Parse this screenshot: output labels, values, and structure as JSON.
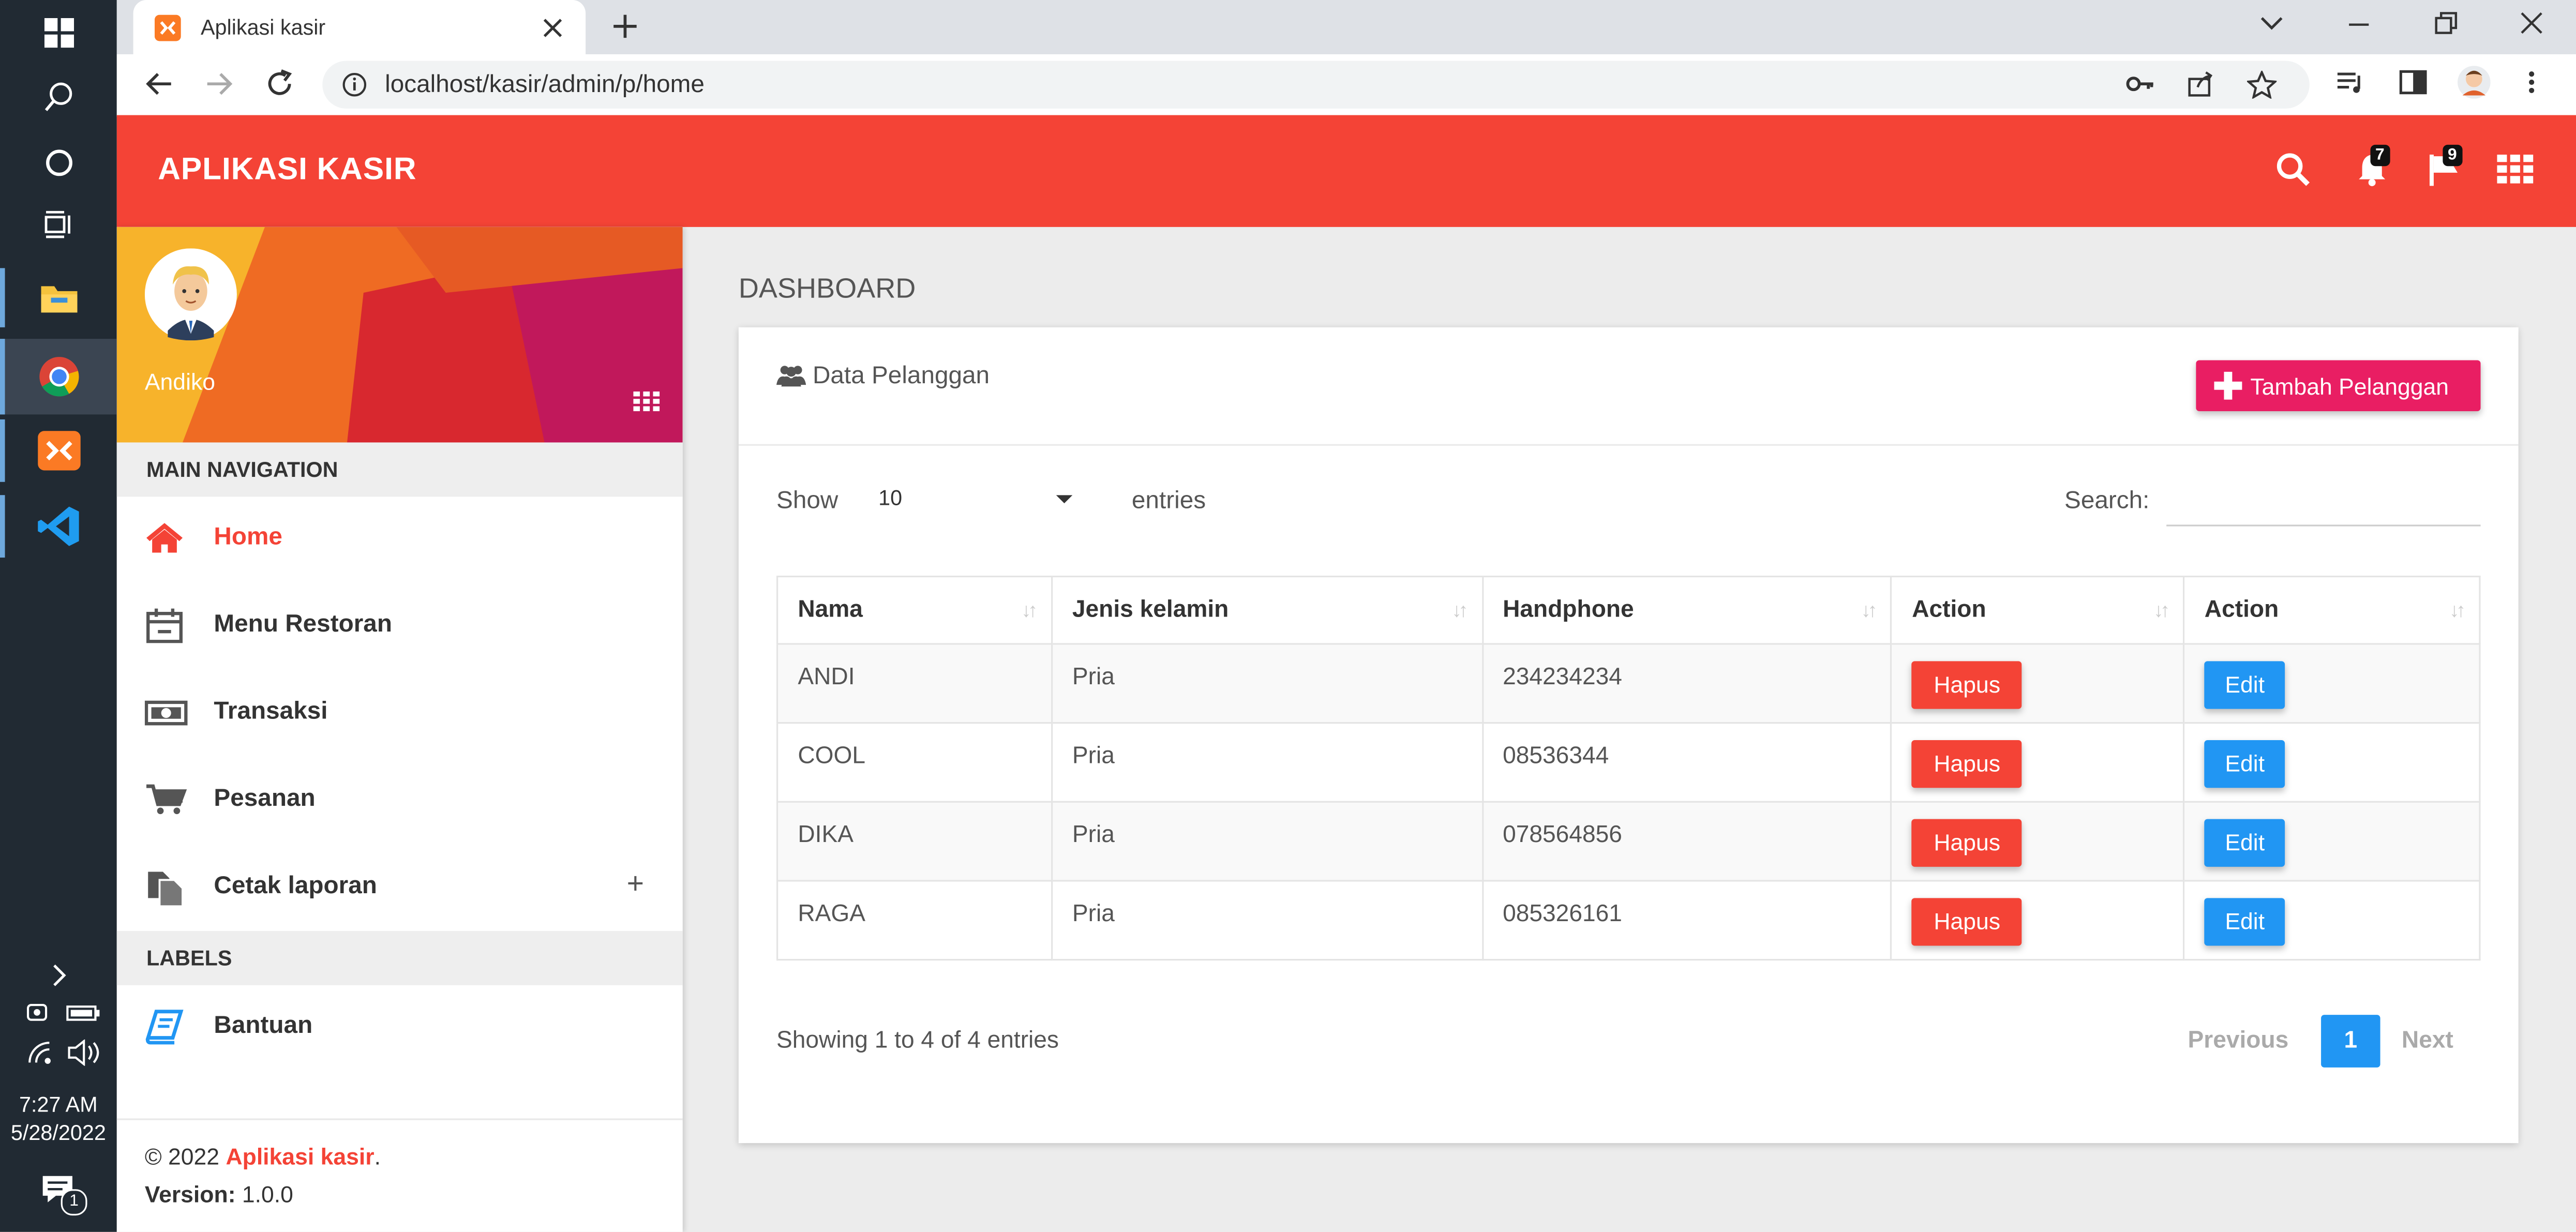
{
  "taskbar": {
    "time": "7:27 AM",
    "date": "5/28/2022",
    "notification_count": "1"
  },
  "browser": {
    "tab_title": "Aplikasi kasir",
    "url": "localhost/kasir/admin/p/home"
  },
  "app": {
    "title": "APLIKASI KASIR",
    "notifications_count": "7",
    "flags_count": "9",
    "accent_color": "#f44336"
  },
  "sidebar": {
    "user_name": "Andiko",
    "main_nav_heading": "MAIN NAVIGATION",
    "items": [
      {
        "label": "Home",
        "icon": "home-icon",
        "active": true
      },
      {
        "label": "Menu Restoran",
        "icon": "calendar-icon"
      },
      {
        "label": "Transaksi",
        "icon": "money-icon"
      },
      {
        "label": "Pesanan",
        "icon": "cart-icon"
      },
      {
        "label": "Cetak laporan",
        "icon": "copy-icon",
        "expand": "+"
      }
    ],
    "labels_heading": "LABELS",
    "label_items": [
      {
        "label": "Bantuan",
        "icon": "book-icon"
      }
    ],
    "footer": {
      "copyright": "© 2022 ",
      "brand": "Aplikasi kasir",
      "period": ".",
      "version_label": "Version:",
      "version": "1.0.0"
    }
  },
  "main": {
    "page_title": "DASHBOARD",
    "card_title": "Data Pelanggan",
    "add_button": "Tambah Pelanggan",
    "show_label": "Show",
    "page_size": "10",
    "entries_label": "entries",
    "search_label": "Search:",
    "search_value": "",
    "table": {
      "headers": [
        "Nama",
        "Jenis kelamin",
        "Handphone",
        "Action",
        "Action"
      ],
      "rows": [
        {
          "nama": "ANDI",
          "jenis_kelamin": "Pria",
          "handphone": "234234234",
          "delete": "Hapus",
          "edit": "Edit"
        },
        {
          "nama": "COOL",
          "jenis_kelamin": "Pria",
          "handphone": "08536344",
          "delete": "Hapus",
          "edit": "Edit"
        },
        {
          "nama": "DIKA",
          "jenis_kelamin": "Pria",
          "handphone": "078564856",
          "delete": "Hapus",
          "edit": "Edit"
        },
        {
          "nama": "RAGA",
          "jenis_kelamin": "Pria",
          "handphone": "085326161",
          "delete": "Hapus",
          "edit": "Edit"
        }
      ]
    },
    "info": "Showing 1 to 4 of 4 entries",
    "pagination": {
      "previous": "Previous",
      "current": "1",
      "next": "Next"
    },
    "colors": {
      "delete": "#f44336",
      "edit": "#2196f3",
      "add": "#e91e63"
    }
  }
}
